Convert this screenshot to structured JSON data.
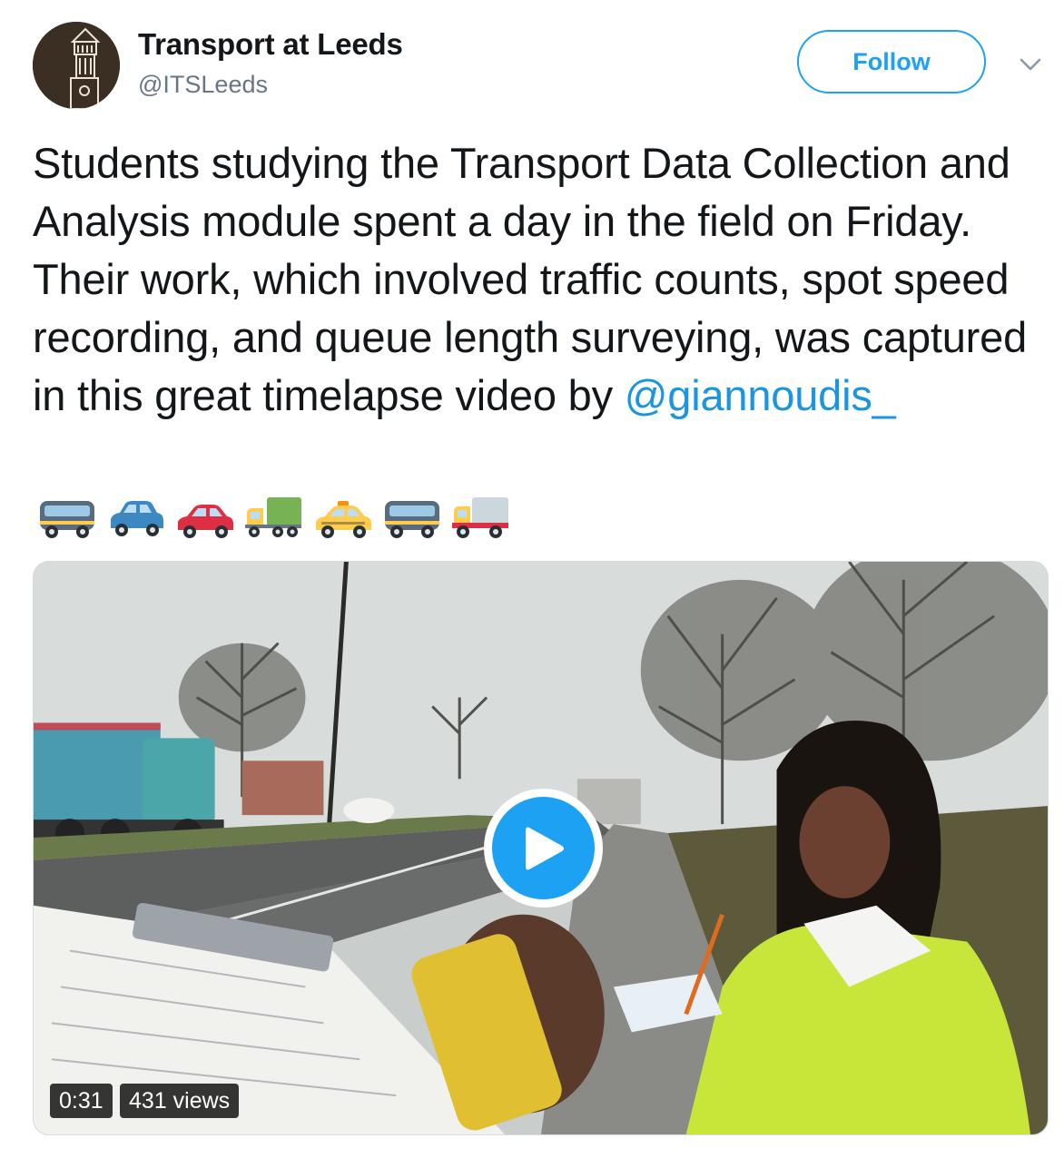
{
  "account": {
    "display_name": "Transport at Leeds",
    "handle": "@ITSLeeds",
    "avatar_icon": "university-clock-tower-icon"
  },
  "follow": {
    "label": "Follow"
  },
  "menu": {
    "icon": "chevron-down-icon"
  },
  "tweet": {
    "text": "Students studying the Transport Data Collection and Analysis module spent a day in the field on Friday. Their work, which involved traffic counts, spot speed recording, and queue length surveying, was captured in this great timelapse video by ",
    "mention": "@giannoudis_",
    "emojis": [
      "bus",
      "blue-car",
      "red-car",
      "articulated-lorry",
      "taxi",
      "bus",
      "delivery-truck"
    ]
  },
  "video": {
    "duration": "0:31",
    "views": "431 views",
    "play_icon": "play-icon"
  },
  "colors": {
    "accent": "#1da1f2",
    "mention": "#1b95e0",
    "text": "#14171a",
    "secondary": "#657786"
  }
}
